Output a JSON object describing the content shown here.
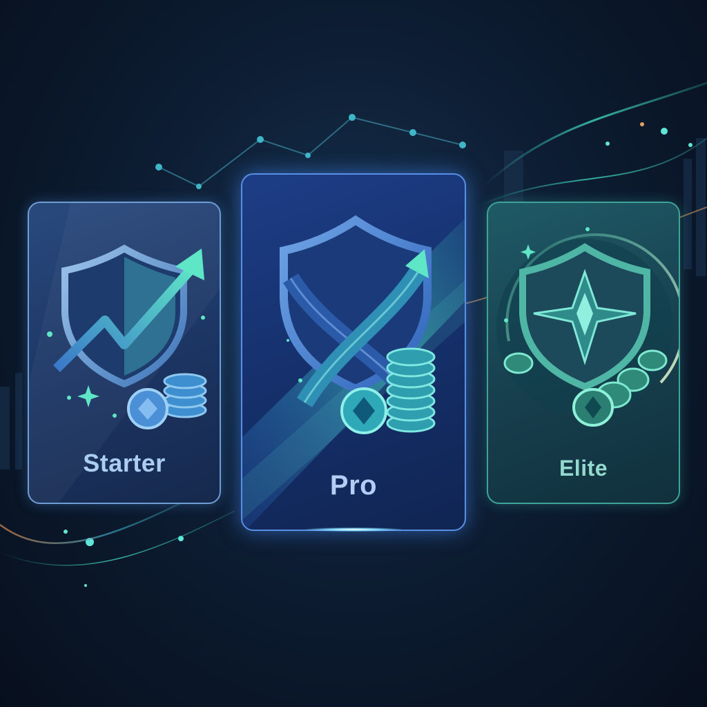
{
  "cards": [
    {
      "name": "starter",
      "label": "Starter",
      "icon": "shield-arrow-icon"
    },
    {
      "name": "pro",
      "label": "Pro",
      "icon": "shield-crossed-icon"
    },
    {
      "name": "elite",
      "label": "Elite",
      "icon": "shield-star-icon"
    }
  ],
  "colors": {
    "background": "#0d1d33",
    "accent_blue": "#5a8fe6",
    "accent_teal": "#3fd6c0",
    "text_starter": "#aacdf0",
    "text_pro": "#b3cdf5",
    "text_elite": "#93d9cf"
  }
}
